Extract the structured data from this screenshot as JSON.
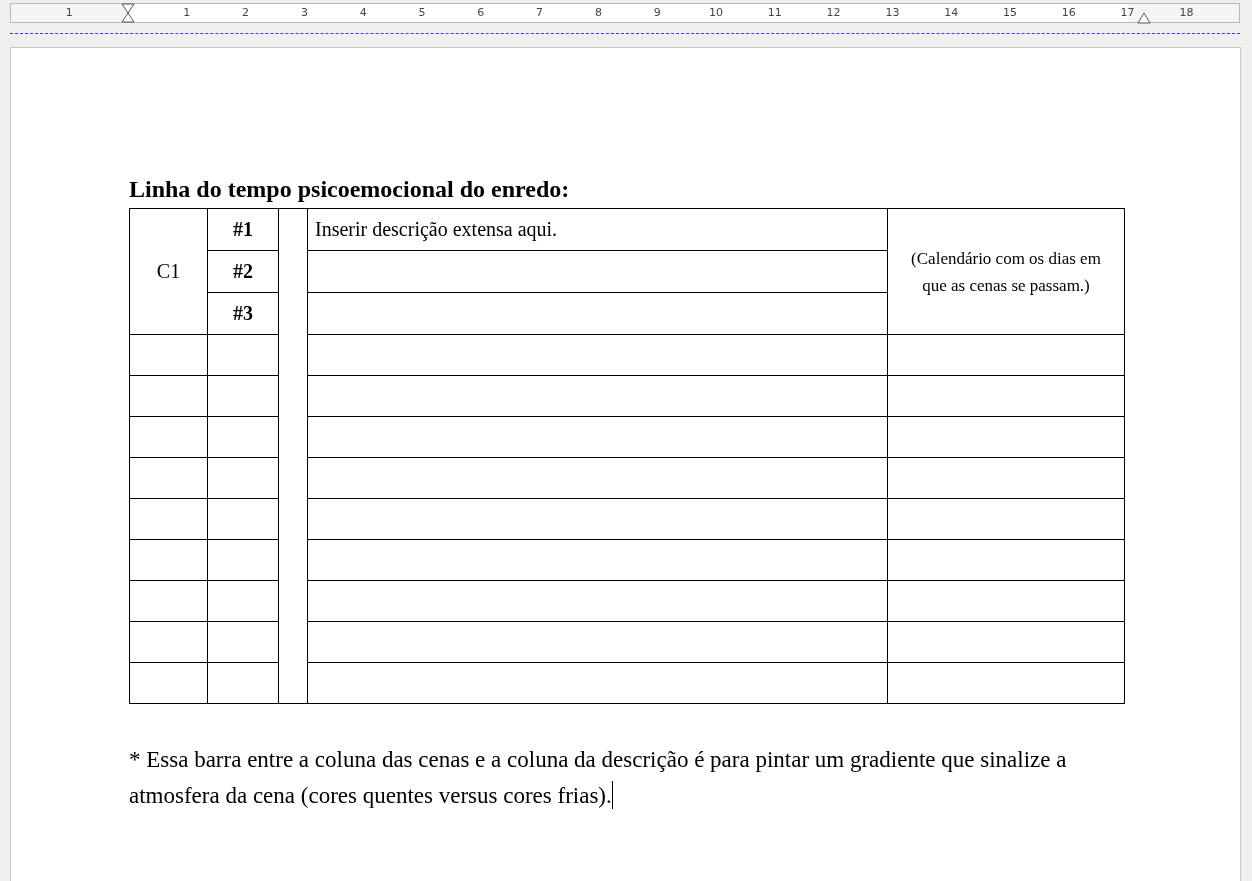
{
  "ruler": {
    "labels": [
      "1",
      "1",
      "2",
      "3",
      "4",
      "5",
      "6",
      "7",
      "8",
      "9",
      "10",
      "11",
      "12",
      "13",
      "14",
      "15",
      "16",
      "17",
      "18"
    ]
  },
  "document": {
    "heading": "Linha do tempo psicoemocional do enredo:",
    "table": {
      "chapter": "C1",
      "scenes": [
        "#1",
        "#2",
        "#3"
      ],
      "description": "Inserir descrição extensa aqui.",
      "calendar_note": "(Calendário com os dias em que as cenas se passam.)"
    },
    "footnote": "* Essa barra entre a coluna das cenas e a coluna da descrição é para pintar um gradiente que sinalize a atmosfera da cena (cores quentes versus cores frias)."
  }
}
